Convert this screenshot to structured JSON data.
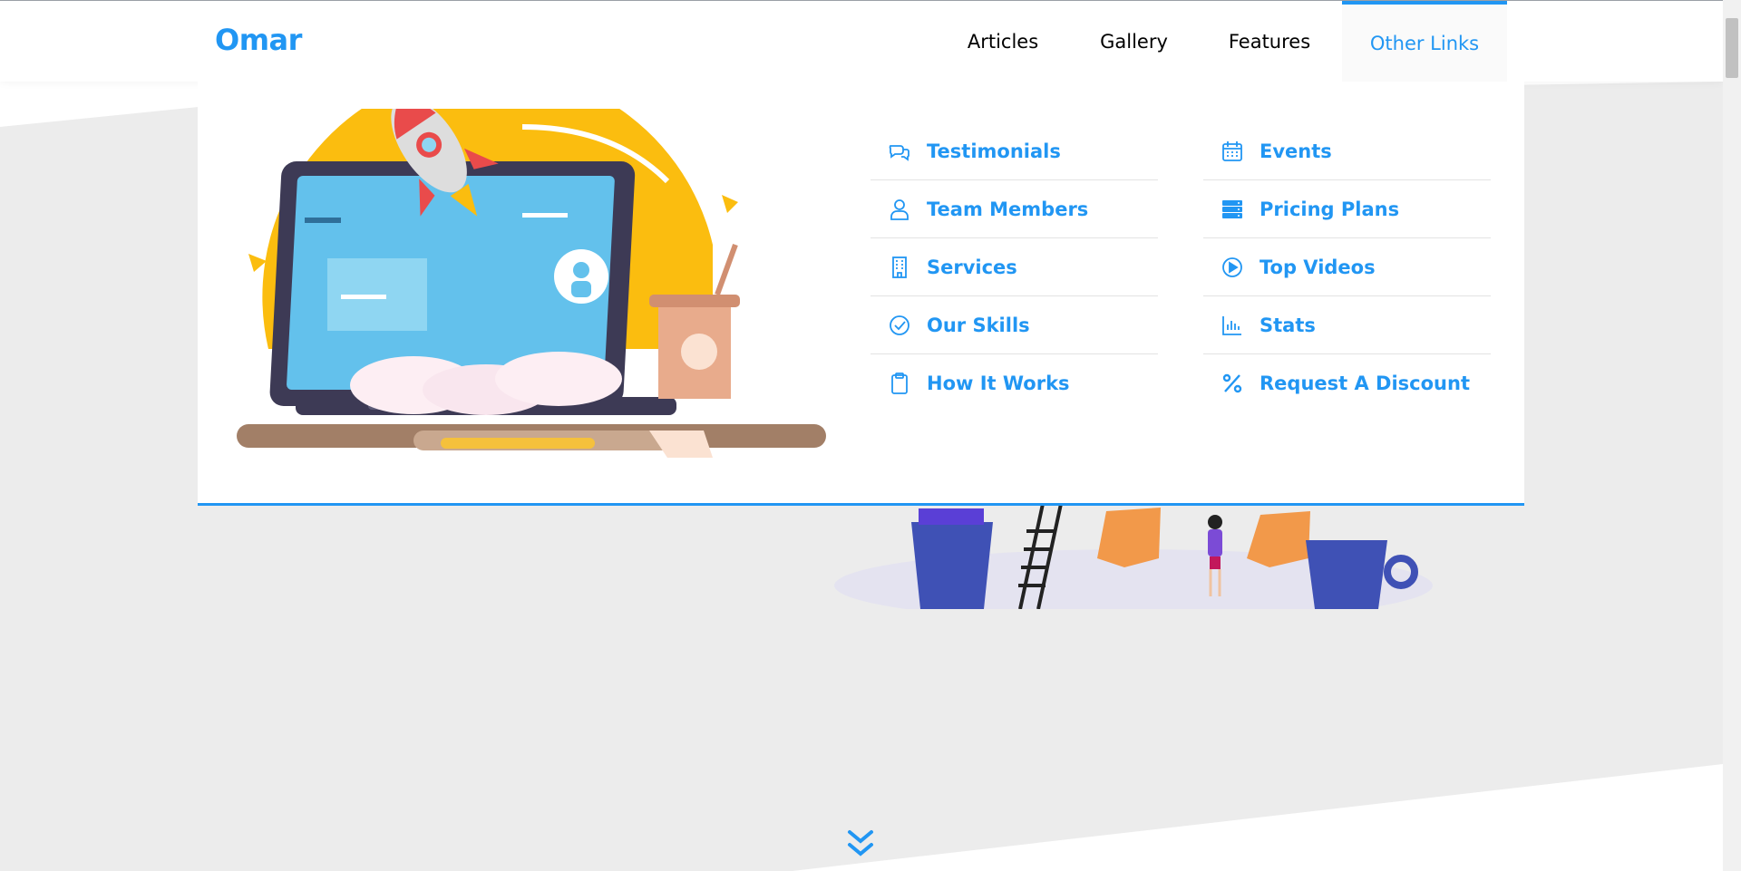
{
  "brand": {
    "logo_text": "Omar"
  },
  "nav": {
    "items": [
      {
        "label": "Articles"
      },
      {
        "label": "Gallery"
      },
      {
        "label": "Features"
      },
      {
        "label": "Other Links",
        "active": true
      }
    ]
  },
  "mega_menu": {
    "columns": [
      [
        {
          "label": "Testimonials",
          "icon": "comments-icon"
        },
        {
          "label": "Team Members",
          "icon": "user-icon"
        },
        {
          "label": "Services",
          "icon": "building-icon"
        },
        {
          "label": "Our Skills",
          "icon": "check-circle-icon"
        },
        {
          "label": "How It Works",
          "icon": "clipboard-icon"
        }
      ],
      [
        {
          "label": "Events",
          "icon": "calendar-icon"
        },
        {
          "label": "Pricing Plans",
          "icon": "server-icon"
        },
        {
          "label": "Top Videos",
          "icon": "play-circle-icon"
        },
        {
          "label": "Stats",
          "icon": "chart-bar-icon"
        },
        {
          "label": "Request A Discount",
          "icon": "percent-icon"
        }
      ]
    ]
  },
  "colors": {
    "accent": "#2196f3",
    "background": "#ececec"
  },
  "scroll_down": {
    "icon": "angle-double-down-icon"
  }
}
